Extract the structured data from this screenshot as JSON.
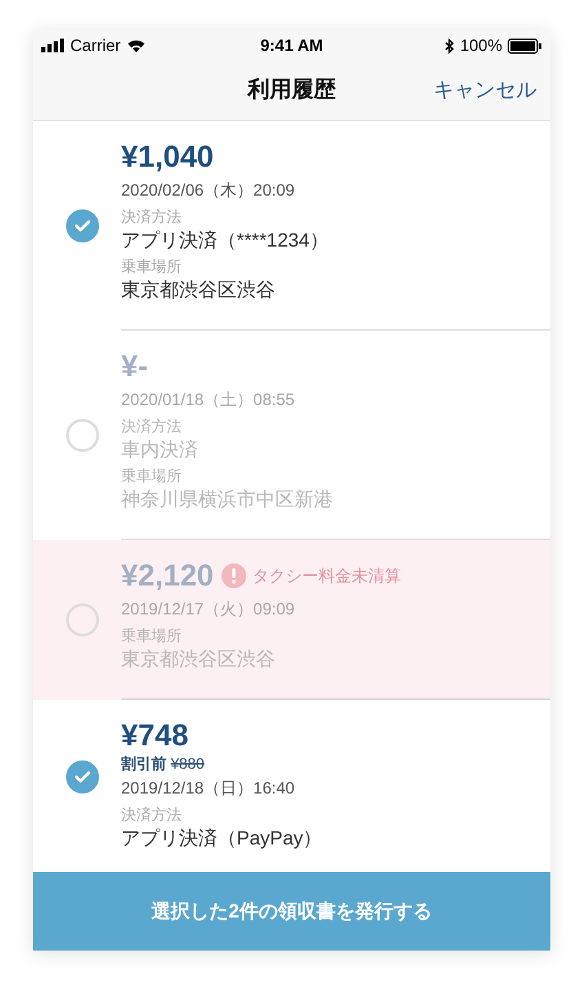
{
  "status_bar": {
    "carrier": "Carrier",
    "time": "9:41 AM",
    "battery": "100%"
  },
  "nav": {
    "title": "利用履歴",
    "cancel": "キャンセル"
  },
  "items": [
    {
      "selected": true,
      "disabled": false,
      "unpaid": false,
      "amount": "¥1,040",
      "datetime": "2020/02/06（木）20:09",
      "details": [
        {
          "label": "決済方法",
          "value": "アプリ決済（****1234）"
        },
        {
          "label": "乗車場所",
          "value": "東京都渋谷区渋谷"
        }
      ]
    },
    {
      "selected": false,
      "disabled": true,
      "unpaid": false,
      "amount": "¥-",
      "datetime": "2020/01/18（土）08:55",
      "details": [
        {
          "label": "決済方法",
          "value": "車内決済"
        },
        {
          "label": "乗車場所",
          "value": "神奈川県横浜市中区新港"
        }
      ]
    },
    {
      "selected": false,
      "disabled": true,
      "unpaid": true,
      "amount": "¥2,120",
      "warning": "タクシー料金未清算",
      "datetime": "2019/12/17（火）09:09",
      "details": [
        {
          "label": "乗車場所",
          "value": "東京都渋谷区渋谷"
        }
      ]
    },
    {
      "selected": true,
      "disabled": false,
      "unpaid": false,
      "amount": "¥748",
      "discount": {
        "label": "割引前",
        "original": "¥880"
      },
      "datetime": "2019/12/18（日）16:40",
      "details": [
        {
          "label": "決済方法",
          "value": "アプリ決済（PayPay）"
        }
      ]
    }
  ],
  "issue_button": "選択した2件の領収書を発行する"
}
